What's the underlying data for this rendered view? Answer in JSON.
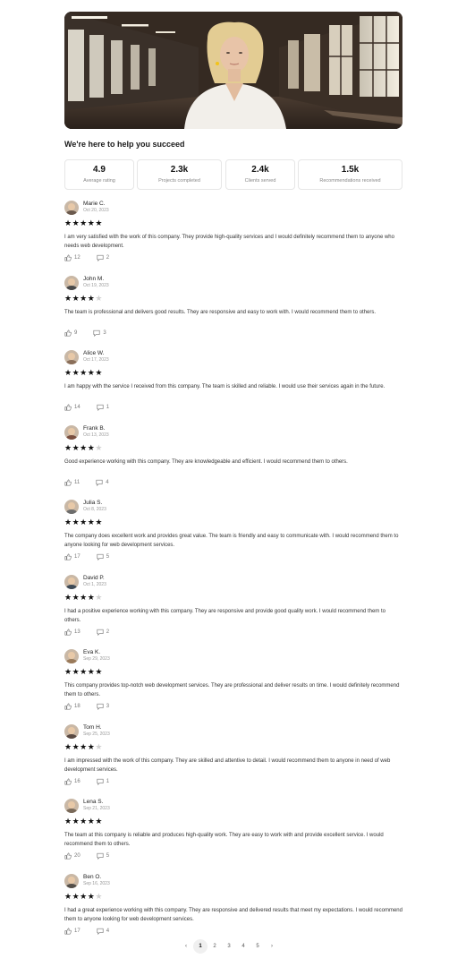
{
  "headline": "We're here to help you succeed",
  "stats": [
    {
      "value": "4.9",
      "label": "Average rating"
    },
    {
      "value": "2.3k",
      "label": "Projects completed"
    },
    {
      "value": "2.4k",
      "label": "Clients served"
    },
    {
      "value": "1.5k",
      "label": "Recommendations received"
    }
  ],
  "reviews": [
    {
      "name": "Marie C.",
      "date": "Oct 20, 2023",
      "rating": 5,
      "text": "I am very satisfied with the work of this company. They provide high-quality services and I would definitely recommend them to anyone who needs web development.",
      "likes": "12",
      "comments": "2",
      "avatar_color": "#6b5a4e"
    },
    {
      "name": "John M.",
      "date": "Oct 19, 2023",
      "rating": 4,
      "text": "The team is professional and delivers good results. They are responsive and easy to work with. I would recommend them to others.",
      "likes": "9",
      "comments": "3",
      "avatar_color": "#4a4a4a"
    },
    {
      "name": "Alice W.",
      "date": "Oct 17, 2023",
      "rating": 5,
      "text": "I am happy with the service I received from this company. The team is skilled and reliable. I would use their services again in the future.",
      "likes": "14",
      "comments": "1",
      "avatar_color": "#8a6f5a"
    },
    {
      "name": "Frank B.",
      "date": "Oct 13, 2023",
      "rating": 4,
      "text": "Good experience working with this company. They are knowledgeable and efficient. I would recommend them to others.",
      "likes": "11",
      "comments": "4",
      "avatar_color": "#7a4f3f"
    },
    {
      "name": "Julia S.",
      "date": "Oct 8, 2023",
      "rating": 5,
      "text": "The company does excellent work and provides great value. The team is friendly and easy to communicate with. I would recommend them to anyone looking for web development services.",
      "likes": "17",
      "comments": "5",
      "avatar_color": "#6d6d6d"
    },
    {
      "name": "David P.",
      "date": "Oct 1, 2023",
      "rating": 4,
      "text": "I had a positive experience working with this company. They are responsive and provide good quality work. I would recommend them to others.",
      "likes": "13",
      "comments": "2",
      "avatar_color": "#3f4a55"
    },
    {
      "name": "Eva K.",
      "date": "Sep 29, 2023",
      "rating": 5,
      "text": "This company provides top-notch web development services. They are professional and deliver results on time. I would definitely recommend them to others.",
      "likes": "18",
      "comments": "3",
      "avatar_color": "#9a7a5a"
    },
    {
      "name": "Tom H.",
      "date": "Sep 25, 2023",
      "rating": 4,
      "text": "I am impressed with the work of this company. They are skilled and attentive to detail. I would recommend them to anyone in need of web development services.",
      "likes": "16",
      "comments": "1",
      "avatar_color": "#5a4a42"
    },
    {
      "name": "Lena S.",
      "date": "Sep 21, 2023",
      "rating": 5,
      "text": "The team at this company is reliable and produces high-quality work. They are easy to work with and provide excellent service. I would recommend them to others.",
      "likes": "20",
      "comments": "5",
      "avatar_color": "#7a6a5a"
    },
    {
      "name": "Ben O.",
      "date": "Sep 16, 2023",
      "rating": 4,
      "text": "I had a great experience working with this company. They are responsive and delivered results that meet my expectations. I would recommend them to anyone looking for web development services.",
      "likes": "17",
      "comments": "4",
      "avatar_color": "#55504a"
    }
  ],
  "pagination": {
    "prev": "‹",
    "pages": [
      "1",
      "2",
      "3",
      "4",
      "5"
    ],
    "next": "›",
    "active": "1"
  },
  "colors": {
    "accent": "#111111",
    "star_off": "#d0d0d0",
    "border": "#e6e6e6"
  }
}
